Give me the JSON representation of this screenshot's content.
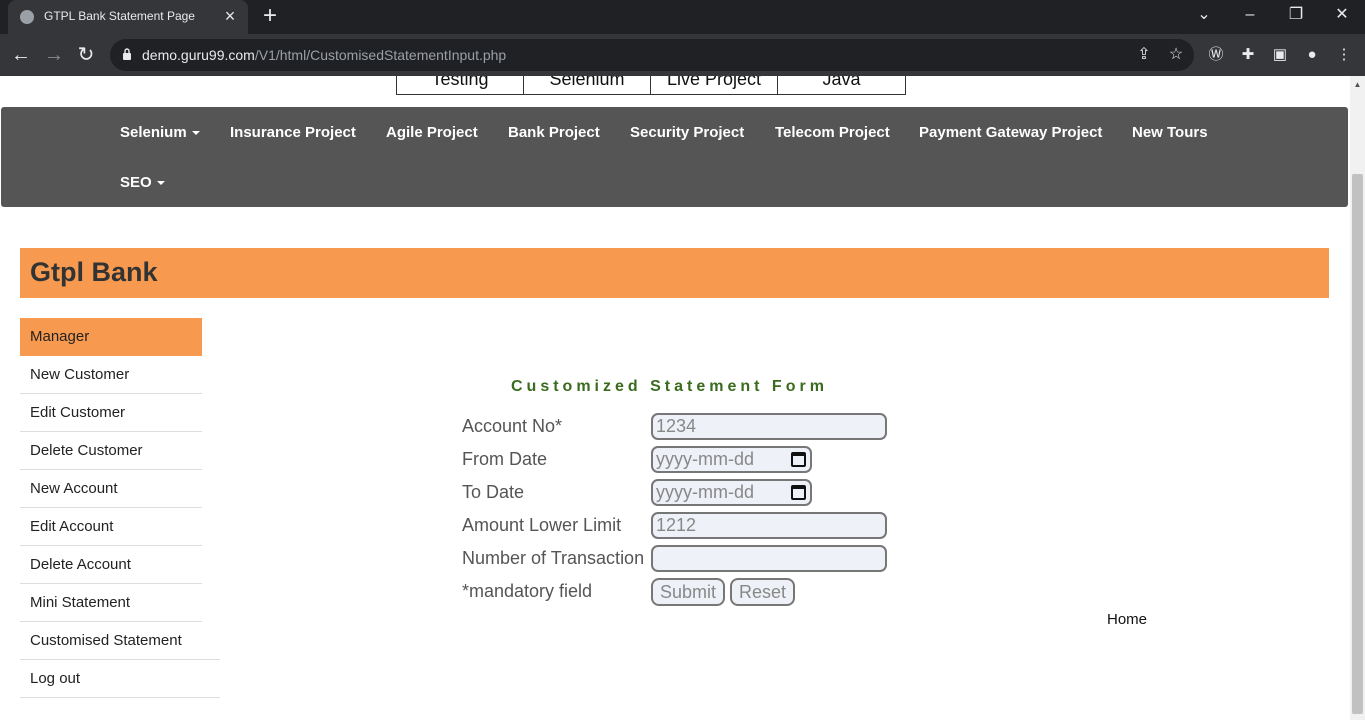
{
  "browser": {
    "tab_title": "GTPL Bank Statement Page",
    "url_host": "demo.guru99.com",
    "url_path": "/V1/html/CustomisedStatementInput.php"
  },
  "top_tabs": [
    "Testing",
    "Selenium",
    "Live Project",
    "Java"
  ],
  "menu": {
    "items": [
      "Selenium",
      "Insurance Project",
      "Agile Project",
      "Bank Project",
      "Security Project",
      "Telecom Project",
      "Payment Gateway Project",
      "New Tours",
      "SEO"
    ]
  },
  "bank": {
    "name": "Gtpl Bank"
  },
  "sidebar": {
    "items": [
      "Manager",
      "New Customer",
      "Edit Customer",
      "Delete Customer",
      "New Account",
      "Edit Account",
      "Delete Account",
      "Mini Statement",
      "Customised Statement",
      "Log out"
    ]
  },
  "form": {
    "title": "Customized Statement Form",
    "account_label": "Account No*",
    "account_value": "1234",
    "from_label": "From Date",
    "from_placeholder": "yyyy-mm-dd",
    "to_label": "To Date",
    "to_placeholder": "yyyy-mm-dd",
    "amount_label": "Amount Lower Limit",
    "amount_value": "1212",
    "txn_label": "Number of Transaction",
    "txn_value": "",
    "mandatory_note": "*mandatory field",
    "submit_label": "Submit",
    "reset_label": "Reset"
  },
  "home_link": "Home"
}
